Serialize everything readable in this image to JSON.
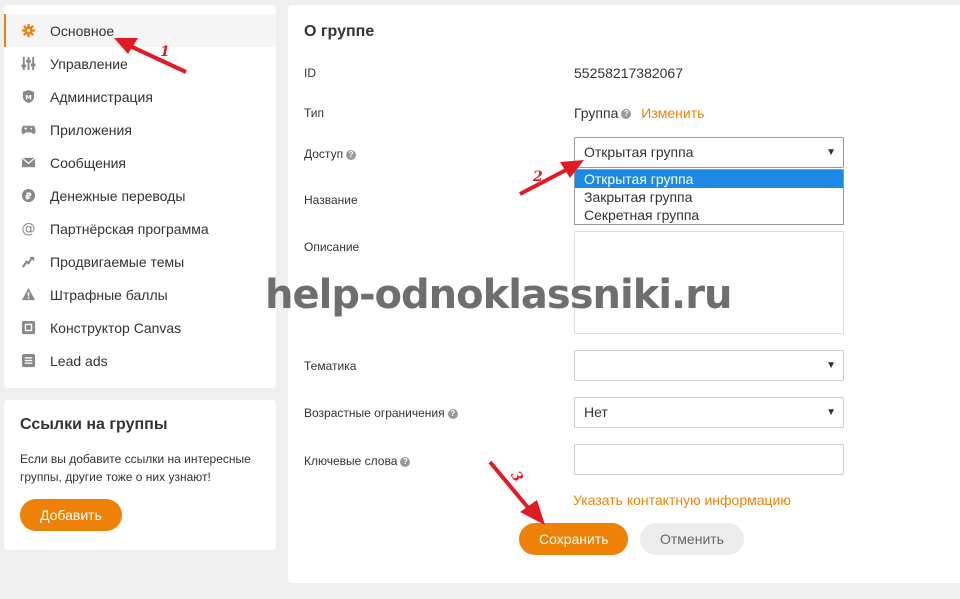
{
  "sidebar": {
    "items": [
      {
        "label": "Основное",
        "icon": "gear-icon",
        "active": true
      },
      {
        "label": "Управление",
        "icon": "sliders-icon"
      },
      {
        "label": "Администрация",
        "icon": "shield-icon"
      },
      {
        "label": "Приложения",
        "icon": "gamepad-icon"
      },
      {
        "label": "Сообщения",
        "icon": "envelope-icon"
      },
      {
        "label": "Денежные переводы",
        "icon": "ruble-icon"
      },
      {
        "label": "Партнёрская программа",
        "icon": "at-icon"
      },
      {
        "label": "Продвигаемые темы",
        "icon": "trend-arrow-icon"
      },
      {
        "label": "Штрафные баллы",
        "icon": "warning-icon"
      },
      {
        "label": "Конструктор Canvas",
        "icon": "canvas-icon"
      },
      {
        "label": "Lead ads",
        "icon": "list-icon"
      }
    ]
  },
  "links_card": {
    "title": "Ссылки на группы",
    "text": "Если вы добавите ссылки на интересные группы, другие тоже о них узнают!",
    "add_label": "Добавить"
  },
  "main": {
    "title": "О группе",
    "id_label": "ID",
    "id_value": "55258217382067",
    "type_label": "Тип",
    "type_value": "Группа",
    "type_change": "Изменить",
    "access_label": "Доступ",
    "access_selected": "Открытая группа",
    "access_options": [
      "Открытая группа",
      "Закрытая группа",
      "Секретная группа"
    ],
    "name_label": "Название",
    "description_label": "Описание",
    "topic_label": "Тематика",
    "topic_value": "",
    "age_label": "Возрастные ограничения",
    "age_value": "Нет",
    "keywords_label": "Ключевые слова",
    "keywords_value": "",
    "contact_link": "Указать контактную информацию",
    "save_label": "Сохранить",
    "cancel_label": "Отменить"
  },
  "watermark": "help-odnoklassniki.ru",
  "annotations": [
    "1",
    "2",
    "3"
  ],
  "colors": {
    "accent": "#ee8208",
    "selected": "#1e88e5",
    "annotation": "#e01b24"
  }
}
